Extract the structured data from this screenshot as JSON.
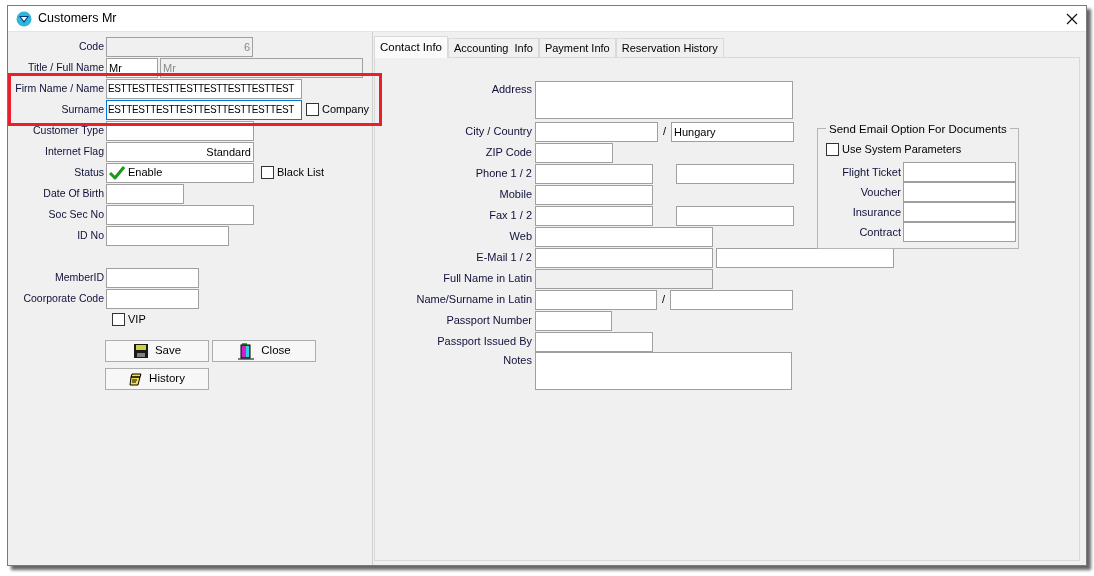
{
  "window": {
    "title": "Customers Mr"
  },
  "left": {
    "fields": [
      {
        "label": "Code",
        "kind": "text",
        "highlighted": false,
        "inputs": [
          {
            "value": "6",
            "disabled": true,
            "focused": false
          }
        ]
      },
      {
        "label": "Title / Full Name",
        "kind": "text",
        "highlighted": false,
        "inputs": [
          {
            "value": "Mr",
            "disabled": false,
            "focused": false
          },
          {
            "value": "Mr",
            "disabled": true,
            "focused": false
          }
        ]
      },
      {
        "label": "Firm Name / Name",
        "kind": "text",
        "highlighted": true,
        "inputs": [
          {
            "value": "ESTTESTTESTTESTTESTTESTTESTTEST",
            "disabled": false,
            "focused": false
          }
        ]
      },
      {
        "label": "Surname",
        "kind": "text",
        "highlighted": true,
        "inputs": [
          {
            "value": "ESTTESTTESTTESTTESTTESTTESTTEST",
            "disabled": false,
            "focused": true
          }
        ],
        "checkbox": {
          "label": "Company",
          "checked": false
        }
      },
      {
        "label": "Customer Type",
        "kind": "text",
        "highlighted": false,
        "inputs": [
          {
            "disabled": false,
            "focused": false
          }
        ]
      },
      {
        "label": "Internet Flag",
        "kind": "text",
        "highlighted": false,
        "inputs": [
          {
            "value": "Standard",
            "disabled": false,
            "focused": false
          }
        ]
      },
      {
        "label": "Status",
        "kind": "status",
        "highlighted": false,
        "inputs": [
          {
            "value": "Enable",
            "disabled": false,
            "focused": false
          }
        ],
        "checkbox": {
          "label": "Black List",
          "checked": false
        }
      },
      {
        "label": "Date Of Birth",
        "kind": "text",
        "highlighted": false,
        "inputs": [
          {
            "disabled": false,
            "focused": false
          }
        ]
      },
      {
        "label": "Soc Sec No",
        "kind": "text",
        "highlighted": false,
        "inputs": [
          {
            "disabled": false,
            "focused": false
          }
        ]
      },
      {
        "label": "ID No",
        "kind": "text",
        "highlighted": false,
        "inputs": [
          {
            "disabled": false,
            "focused": false
          }
        ]
      },
      {
        "label": "MemberID",
        "kind": "text",
        "highlighted": false,
        "inputs": [
          {
            "disabled": false,
            "focused": false
          }
        ]
      },
      {
        "label": "Coorporate Code",
        "kind": "text",
        "highlighted": false,
        "inputs": [
          {
            "disabled": false,
            "focused": false
          }
        ]
      }
    ],
    "vip": {
      "label": "VIP",
      "checked": false
    },
    "buttons": [
      {
        "label": "Save",
        "kind": "save"
      },
      {
        "label": "Close",
        "kind": "close"
      },
      {
        "label": "History",
        "kind": "history"
      }
    ]
  },
  "tabs": [
    {
      "label": "Contact Info",
      "selected": true
    },
    {
      "label": "Accounting  Info",
      "selected": false
    },
    {
      "label": "Payment Info",
      "selected": false
    },
    {
      "label": "Reservation History",
      "selected": false
    }
  ],
  "contact": {
    "fields": [
      {
        "label": "Address",
        "kind": "textarea",
        "inputs": [
          {
            "disabled": false
          }
        ]
      },
      {
        "label": "City / Country",
        "kind": "text",
        "separator": "/",
        "inputs": [
          {
            "disabled": false
          },
          {
            "value": "Hungary",
            "disabled": false
          }
        ]
      },
      {
        "label": "ZIP Code",
        "kind": "text",
        "inputs": [
          {
            "disabled": false
          }
        ]
      },
      {
        "label": "Phone 1 / 2",
        "kind": "text",
        "inputs": [
          {
            "disabled": false
          },
          {
            "disabled": false
          }
        ]
      },
      {
        "label": "Mobile",
        "kind": "text",
        "inputs": [
          {
            "disabled": false
          }
        ]
      },
      {
        "label": "Fax 1 / 2",
        "kind": "text",
        "inputs": [
          {
            "disabled": false
          },
          {
            "disabled": false
          }
        ]
      },
      {
        "label": "Web",
        "kind": "text",
        "inputs": [
          {
            "disabled": false
          }
        ]
      },
      {
        "label": "E-Mail 1 / 2",
        "kind": "text",
        "inputs": [
          {
            "disabled": false
          },
          {
            "disabled": false
          }
        ]
      },
      {
        "label": "Full Name in Latin",
        "kind": "text",
        "inputs": [
          {
            "disabled": true
          }
        ]
      },
      {
        "label": "Name/Surname in Latin",
        "kind": "text",
        "separator": "/",
        "inputs": [
          {
            "disabled": false
          },
          {
            "disabled": false
          }
        ]
      },
      {
        "label": "Passport Number",
        "kind": "text",
        "inputs": [
          {
            "disabled": false
          }
        ]
      },
      {
        "label": "Passport Issued By",
        "kind": "text",
        "inputs": [
          {
            "disabled": false
          }
        ]
      },
      {
        "label": "Notes",
        "kind": "textarea",
        "inputs": [
          {
            "disabled": false
          }
        ]
      }
    ],
    "email_options": {
      "title": "Send Email Option For Documents",
      "use_system": {
        "label": "Use System Parameters",
        "checked": false
      },
      "fields": [
        {
          "label": "Flight Ticket"
        },
        {
          "label": "Voucher"
        },
        {
          "label": "Insurance"
        },
        {
          "label": "Contract"
        }
      ]
    }
  }
}
